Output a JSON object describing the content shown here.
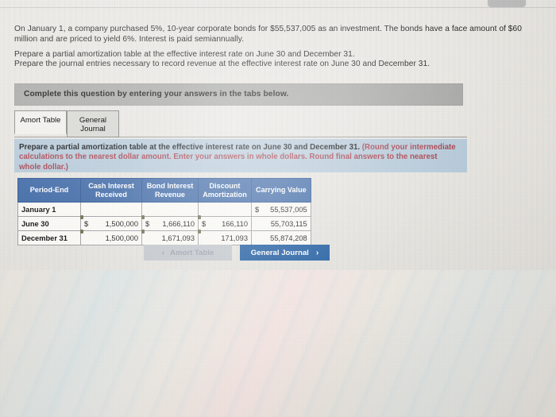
{
  "problem": {
    "paragraph1": "On January 1, a company purchased 5%, 10-year corporate bonds for $55,537,005 as an investment. The bonds have a face amount of $60 million and are priced to yield 6%. Interest is paid semiannually.",
    "paragraph2": "Prepare a partial amortization table at the effective interest rate on June 30 and December 31.",
    "paragraph3": "Prepare the journal entries necessary to record revenue at the effective interest rate on June 30 and December 31."
  },
  "banner": {
    "text": "Complete this question by entering your answers in the tabs below."
  },
  "tabs": [
    {
      "id": "amort-table",
      "label": "Amort Table",
      "active": true
    },
    {
      "id": "general-journal",
      "label": "General Journal",
      "active": false
    }
  ],
  "requirement": {
    "main": "Prepare a partial amortization table at the effective interest rate on June 30 and December 31.",
    "hint": "(Round your intermediate calculations to the nearest dollar amount. Enter your answers in whole dollars. Round final answers to the nearest whole dollar.)"
  },
  "table": {
    "headers": [
      "Period-End",
      "Cash Interest Received",
      "Bond Interest Revenue",
      "Discount Amortization",
      "Carrying Value"
    ],
    "header_lines": {
      "col0": "Period-End",
      "col1a": "Cash Interest",
      "col1b": "Received",
      "col2a": "Bond Interest",
      "col2b": "Revenue",
      "col3a": "Discount",
      "col3b": "Amortization",
      "col4": "Carrying Value"
    },
    "rows": [
      {
        "period": "January 1",
        "cash_interest_received": "",
        "cash_symbol": "",
        "bond_interest_revenue": "",
        "bond_symbol": "",
        "discount_amortization": "",
        "discount_symbol": "",
        "carrying_value": "55,537,005",
        "carrying_symbol": "$"
      },
      {
        "period": "June 30",
        "cash_interest_received": "1,500,000",
        "cash_symbol": "$",
        "bond_interest_revenue": "1,666,110",
        "bond_symbol": "$",
        "discount_amortization": "166,110",
        "discount_symbol": "$",
        "carrying_value": "55,703,115",
        "carrying_symbol": ""
      },
      {
        "period": "December 31",
        "cash_interest_received": "1,500,000",
        "cash_symbol": "",
        "bond_interest_revenue": "1,671,093",
        "bond_symbol": "",
        "discount_amortization": "171,093",
        "discount_symbol": "",
        "carrying_value": "55,874,208",
        "carrying_symbol": ""
      }
    ]
  },
  "nav": {
    "prev_label": "Amort Table",
    "prev_chevron": "‹",
    "prev_disabled": true,
    "next_label": "General Journal",
    "next_chevron": "›",
    "next_disabled": false
  },
  "colors": {
    "banner_gray": "#a9a9a7",
    "panel_blue": "#b7cbdb",
    "table_header_blue": "#3f6aa8",
    "input_yellow": "#e9e9a9",
    "button_blue": "#1d5ba0",
    "hint_red": "#a8404c"
  }
}
